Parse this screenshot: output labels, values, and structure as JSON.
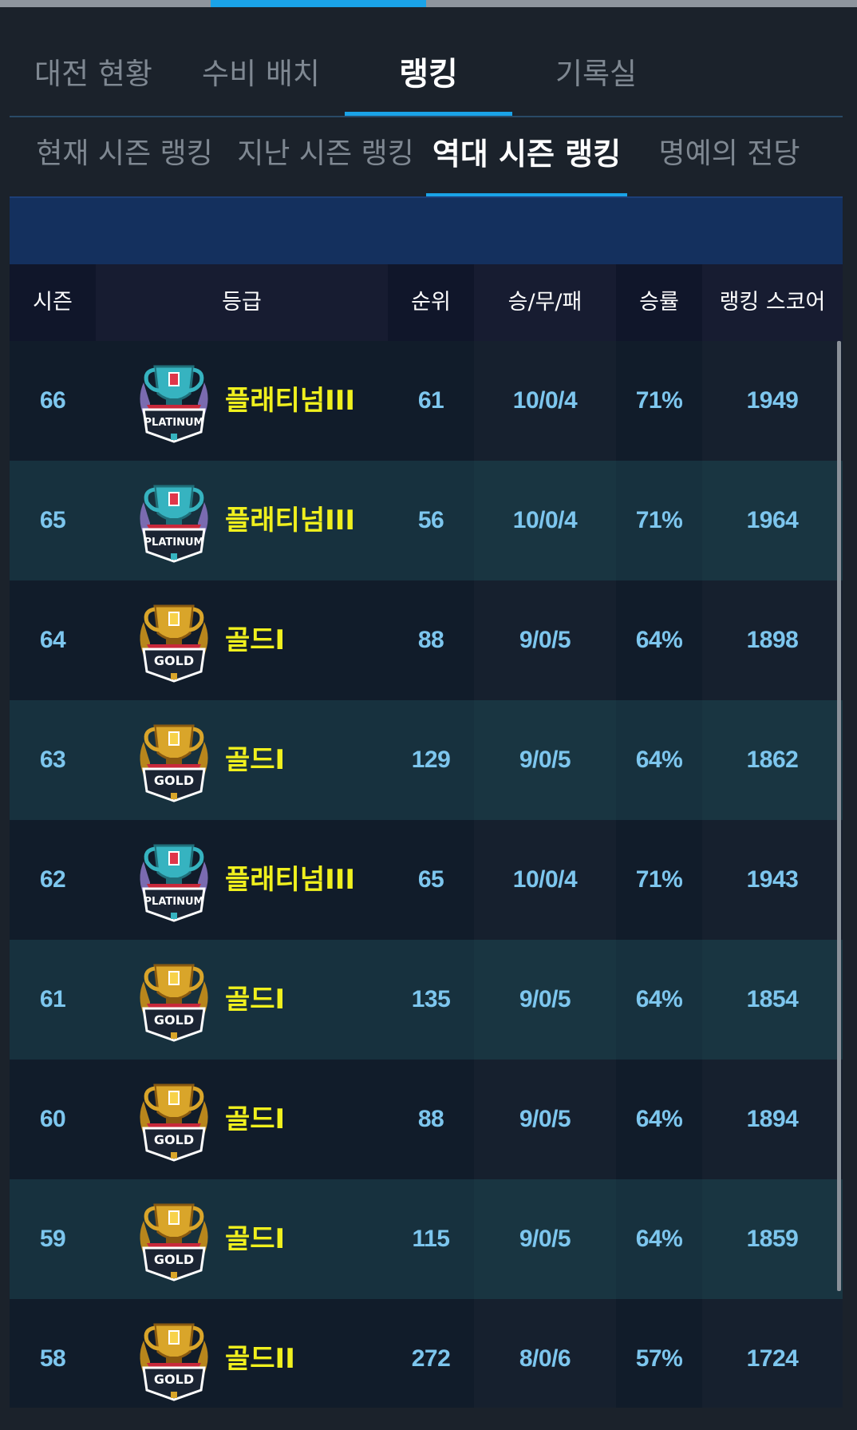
{
  "main_tabs": [
    {
      "label": "대전 현황"
    },
    {
      "label": "수비 배치"
    },
    {
      "label": "랭킹"
    },
    {
      "label": "기록실"
    }
  ],
  "main_active": "랭킹",
  "sub_tabs": [
    {
      "label": "현재 시즌 랭킹"
    },
    {
      "label": "지난 시즌 랭킹"
    },
    {
      "label": "역대 시즌 랭킹"
    },
    {
      "label": "명예의 전당"
    }
  ],
  "sub_active": "역대 시즌 랭킹",
  "table": {
    "headers": {
      "season": "시즌",
      "grade": "등급",
      "rank": "순위",
      "record": "승/무/패",
      "winrate": "승률",
      "score": "랭킹 스코어"
    },
    "rows": [
      {
        "season": "66",
        "badge": "platinum-badge-icon",
        "badge_text": "PLATINUM",
        "grade": "플래티넘III",
        "rank": "61",
        "record": "10/0/4",
        "winrate": "71%",
        "score": "1949"
      },
      {
        "season": "65",
        "badge": "platinum-badge-icon",
        "badge_text": "PLATINUM",
        "grade": "플래티넘III",
        "rank": "56",
        "record": "10/0/4",
        "winrate": "71%",
        "score": "1964"
      },
      {
        "season": "64",
        "badge": "gold-badge-icon",
        "badge_text": "GOLD",
        "grade": "골드I",
        "rank": "88",
        "record": "9/0/5",
        "winrate": "64%",
        "score": "1898"
      },
      {
        "season": "63",
        "badge": "gold-badge-icon",
        "badge_text": "GOLD",
        "grade": "골드I",
        "rank": "129",
        "record": "9/0/5",
        "winrate": "64%",
        "score": "1862"
      },
      {
        "season": "62",
        "badge": "platinum-badge-icon",
        "badge_text": "PLATINUM",
        "grade": "플래티넘III",
        "rank": "65",
        "record": "10/0/4",
        "winrate": "71%",
        "score": "1943"
      },
      {
        "season": "61",
        "badge": "gold-badge-icon",
        "badge_text": "GOLD",
        "grade": "골드I",
        "rank": "135",
        "record": "9/0/5",
        "winrate": "64%",
        "score": "1854"
      },
      {
        "season": "60",
        "badge": "gold-badge-icon",
        "badge_text": "GOLD",
        "grade": "골드I",
        "rank": "88",
        "record": "9/0/5",
        "winrate": "64%",
        "score": "1894"
      },
      {
        "season": "59",
        "badge": "gold-badge-icon",
        "badge_text": "GOLD",
        "grade": "골드I",
        "rank": "115",
        "record": "9/0/5",
        "winrate": "64%",
        "score": "1859"
      },
      {
        "season": "58",
        "badge": "gold-badge-icon",
        "badge_text": "GOLD",
        "grade": "골드II",
        "rank": "272",
        "record": "8/0/6",
        "winrate": "57%",
        "score": "1724"
      }
    ]
  },
  "colors": {
    "accent": "#1aa3e8",
    "grade_text": "#f0f01e",
    "value_text": "#7dc6ee",
    "platinum": "#3fb8c4",
    "gold": "#d9a52a"
  }
}
